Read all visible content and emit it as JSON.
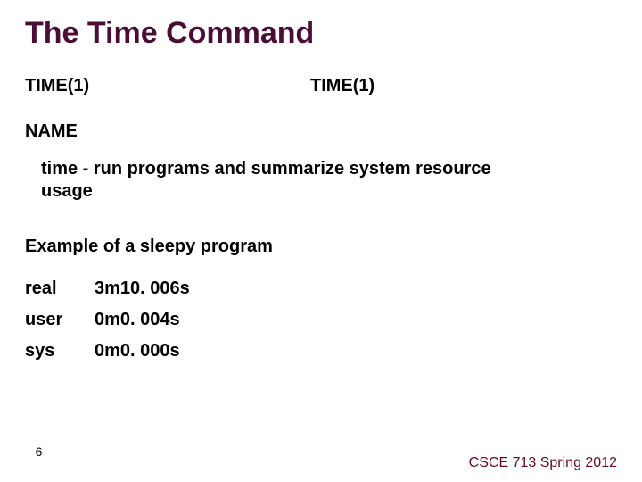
{
  "title": "The Time Command",
  "man": {
    "left": "TIME(1)",
    "right": "TIME(1)"
  },
  "name_heading": "NAME",
  "name_desc": "time - run programs and summarize system resource usage",
  "example_heading": "Example of a sleepy program",
  "timings": [
    {
      "label": "real",
      "value": "3m10. 006s"
    },
    {
      "label": "user",
      "value": " 0m0. 004s"
    },
    {
      "label": "sys",
      "value": " 0m0. 000s"
    }
  ],
  "footer": {
    "page": "– 6 –",
    "course": "CSCE 713 Spring 2012"
  }
}
